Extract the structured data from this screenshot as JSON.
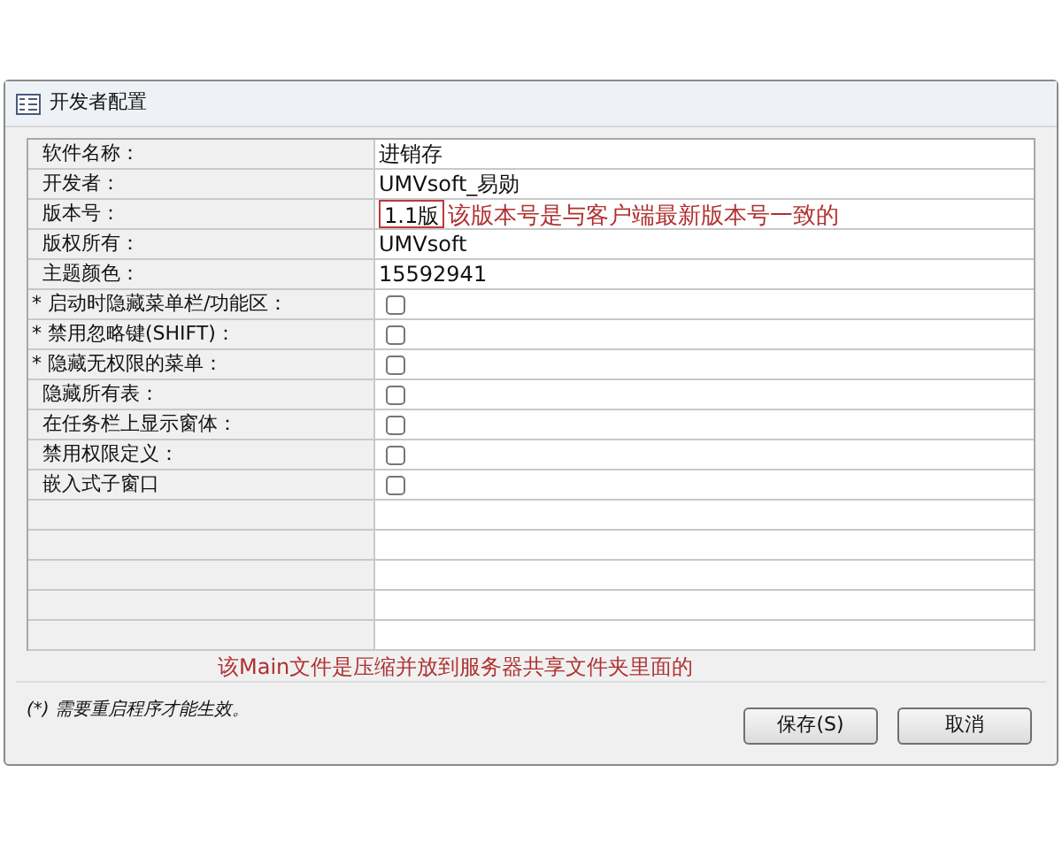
{
  "window": {
    "title": "开发者配置"
  },
  "rows": [
    {
      "label": "软件名称：",
      "kind": "text",
      "value": "进销存",
      "boxed": false
    },
    {
      "label": "开发者：",
      "kind": "text",
      "value": "UMVsoft_易勋",
      "boxed": false
    },
    {
      "label": "版本号：",
      "kind": "text",
      "value": "1.1版",
      "boxed": true,
      "note": "该版本号是与客户端最新版本号一致的"
    },
    {
      "label": "版权所有：",
      "kind": "text",
      "value": "UMVsoft",
      "boxed": false
    },
    {
      "label": "主题颜色：",
      "kind": "text",
      "value": "15592941",
      "boxed": false
    },
    {
      "label": "* 启动时隐藏菜单栏/功能区：",
      "kind": "checkbox",
      "checked": false
    },
    {
      "label": "* 禁用忽略键(SHIFT)：",
      "kind": "checkbox",
      "checked": false
    },
    {
      "label": "* 隐藏无权限的菜单：",
      "kind": "checkbox",
      "checked": false
    },
    {
      "label": "隐藏所有表：",
      "kind": "checkbox",
      "checked": false
    },
    {
      "label": "在任务栏上显示窗体：",
      "kind": "checkbox",
      "checked": false
    },
    {
      "label": "禁用权限定义：",
      "kind": "checkbox",
      "checked": false
    },
    {
      "label": "嵌入式子窗口",
      "kind": "checkbox",
      "checked": false
    }
  ],
  "annotation": "该Main文件是压缩并放到服务器共享文件夹里面的",
  "footnote": "(*) 需要重启程序才能生效。",
  "buttons": [
    "保存(S)",
    "取消"
  ]
}
